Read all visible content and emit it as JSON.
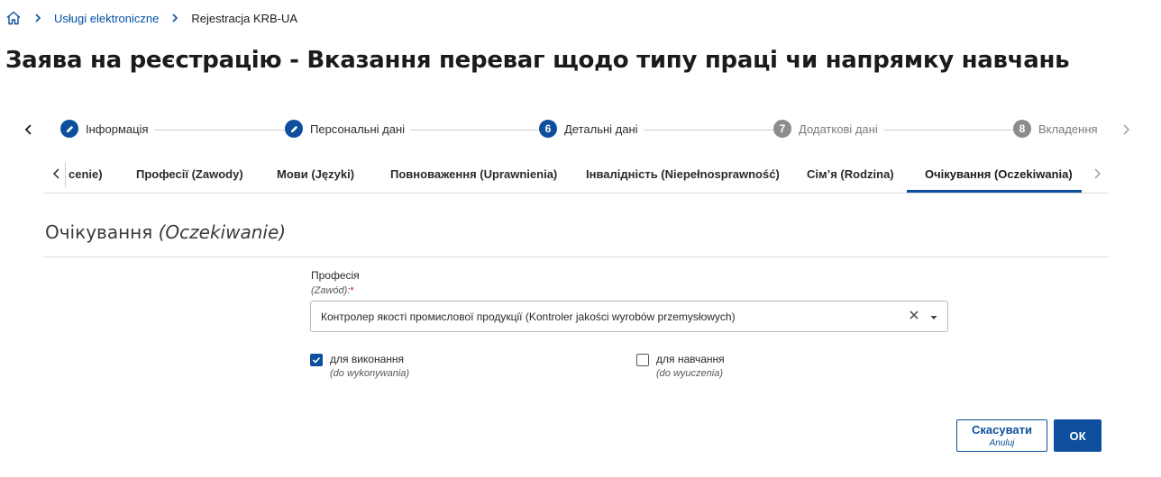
{
  "breadcrumb": {
    "home_icon": "home-icon",
    "items": [
      "Usługi elektroniczne",
      "Rejestracja KRB-UA"
    ]
  },
  "page": {
    "title": "Заява на реєстрацію - Вказання переваг щодо типу праці чи напрямку навчань"
  },
  "stepper": {
    "steps": [
      {
        "marker": "pencil-icon",
        "label": "Інформація",
        "state": "done"
      },
      {
        "marker": "pencil-icon",
        "label": "Персональні дані",
        "state": "done"
      },
      {
        "marker": "6",
        "label": "Детальні дані",
        "state": "active"
      },
      {
        "marker": "7",
        "label": "Додаткові дані",
        "state": "todo"
      },
      {
        "marker": "8",
        "label": "Вкладення",
        "state": "todo"
      }
    ]
  },
  "tabs": {
    "items": [
      "cenie)",
      "Професії (Zawody)",
      "Мови (Języki)",
      "Повноваження (Uprawnienia)",
      "Інвалідність (Niepełnosprawność)",
      "Сім’я (Rodzina)",
      "Очікування (Oczekiwania)"
    ],
    "active_index": 6
  },
  "section": {
    "title_main": "Очікування ",
    "title_sub": "(Oczekiwanie)"
  },
  "form": {
    "profession_label": "Професія",
    "profession_sublabel": "(Zawód):",
    "required_mark": "*",
    "profession_value": "Контролер якості промислової продукції (Kontroler jakości wyrobów przemysłowych)",
    "checkbox_work": {
      "label": "для виконання",
      "sublabel": "(do wykonywania)",
      "checked": true
    },
    "checkbox_study": {
      "label": "для навчання",
      "sublabel": "(do wyuczenia)",
      "checked": false
    }
  },
  "buttons": {
    "cancel_label": "Скасувати",
    "cancel_sublabel": "Anuluj",
    "ok_label": "ОК"
  },
  "colors": {
    "accent": "#0d4f9c",
    "link": "#0052a5",
    "required": "#c0182b",
    "inactive_step": "#8c8c8c"
  }
}
